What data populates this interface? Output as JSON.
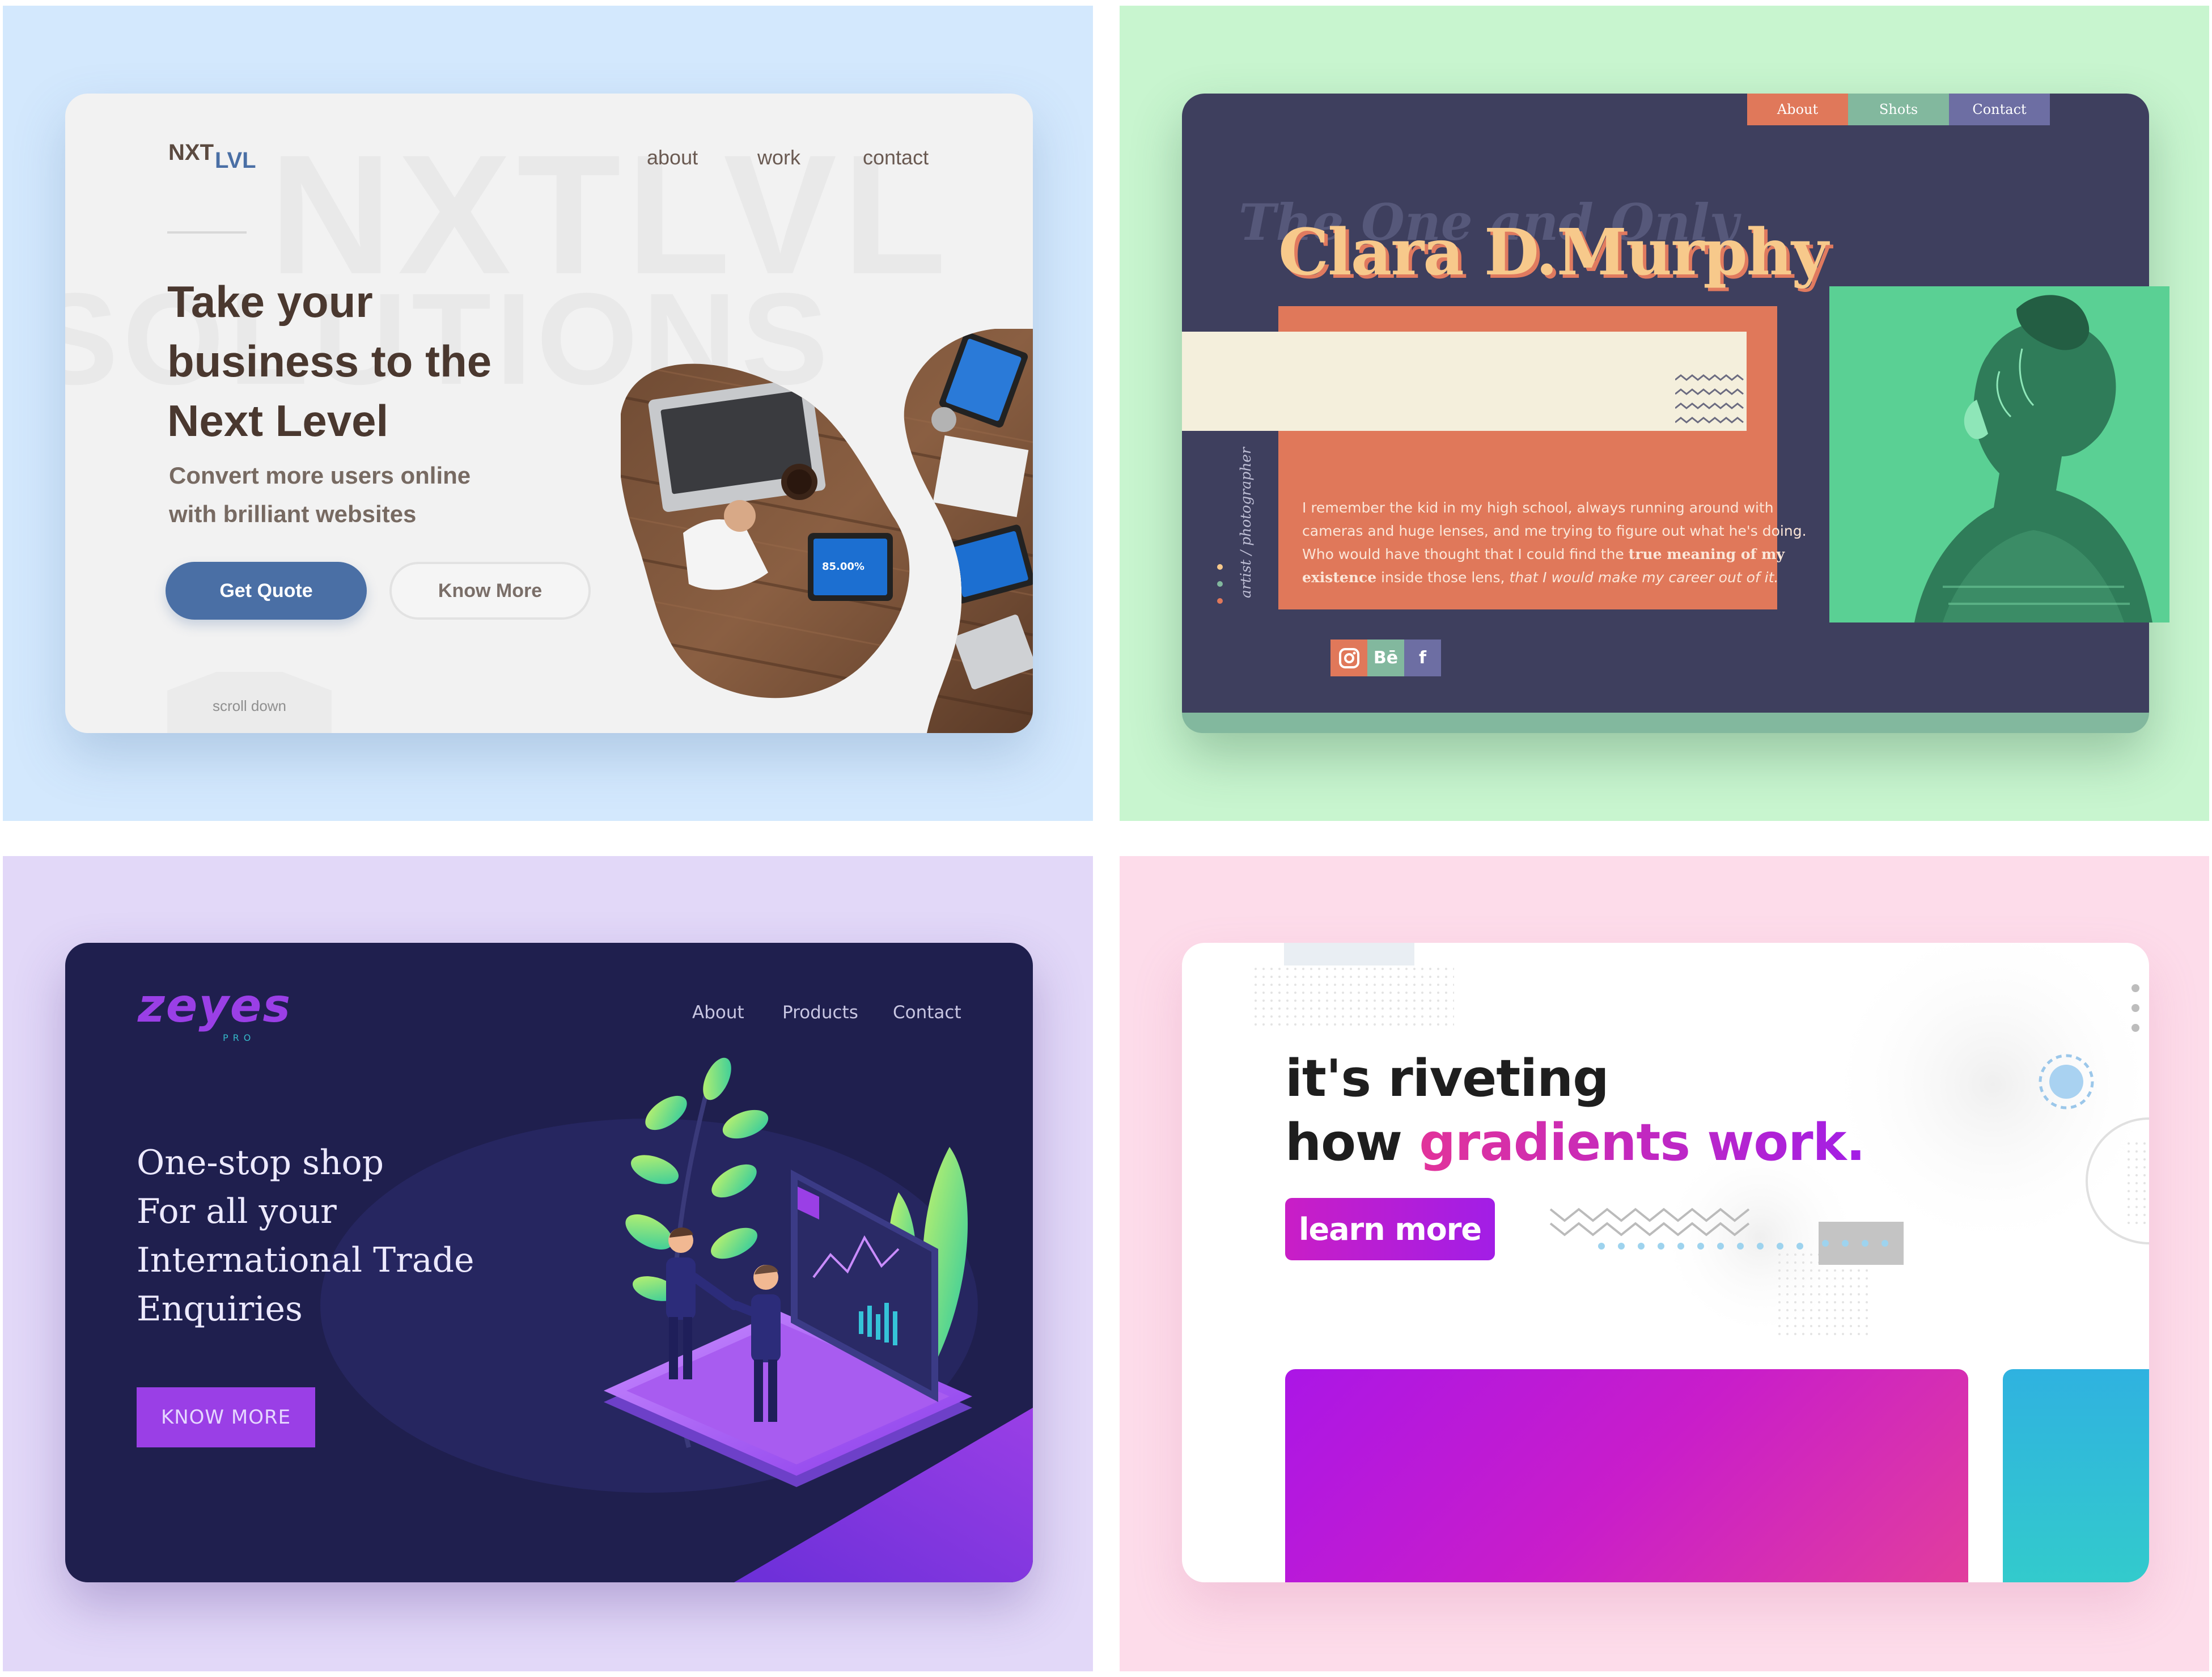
{
  "colors": {
    "q1_bg": "#d3e8fd",
    "q1_accent": "#4a6fa5",
    "q2_bg": "#c8f5cf",
    "q2_card": "#3e3f5e",
    "q2_orange": "#e0785a",
    "q3_bg": "#e2d8f8",
    "q3_card": "#1f1f4e",
    "q3_accent": "#9a3fe6",
    "q4_bg": "#fddcea",
    "q4_gradient_start": "#e2339a",
    "q4_gradient_end": "#a21ee6"
  },
  "nxtlvl": {
    "logo_main": "NXT",
    "logo_sub": "LVL",
    "watermark_line1": "NXTLVL",
    "watermark_line2": "SOLUTIONS",
    "nav": [
      "about",
      "work",
      "contact"
    ],
    "headline_lines": [
      "Take your",
      "business to the",
      "Next Level"
    ],
    "sub_lines": [
      "Convert more users online",
      "with brilliant websites"
    ],
    "primary_button": "Get Quote",
    "secondary_button": "Know More",
    "scroll_label": "scroll down",
    "tablet_reading": "85.00%"
  },
  "clara": {
    "tabs": [
      {
        "label": "About",
        "color": "#e0785a"
      },
      {
        "label": "Shots",
        "color": "#82b89e"
      },
      {
        "label": "Contact",
        "color": "#6d6ea3"
      }
    ],
    "ghost_text": "The One and Only",
    "name": "Clara D.Murphy",
    "role": "artist / photographer",
    "bio_part1": "I remember the kid in my high school, always running around with cameras and huge lenses, and me trying to figure out what he's doing. Who would have thought that I could find the ",
    "bio_bold": "true meaning of my existence",
    "bio_part2": " inside those lens, ",
    "bio_italic": "that I would make my career out of it.",
    "social_icons": [
      {
        "name": "instagram-icon",
        "glyph": "",
        "color": "#e0785a"
      },
      {
        "name": "behance-icon",
        "glyph": "Bē",
        "color": "#82b89e"
      },
      {
        "name": "facebook-icon",
        "glyph": "f",
        "color": "#6d6ea3"
      }
    ]
  },
  "zeyes": {
    "logo": "zeyes",
    "logo_sub": "PRO",
    "nav": [
      "About",
      "Products",
      "Contact"
    ],
    "headline_lines": [
      "One-stop shop",
      "For all your",
      "International Trade",
      "Enquiries"
    ],
    "button": "KNOW  MORE"
  },
  "gradients": {
    "headline_line1": "it's riveting",
    "headline_prefix": "how ",
    "headline_gradient": "gradients work.",
    "button": "learn more"
  }
}
